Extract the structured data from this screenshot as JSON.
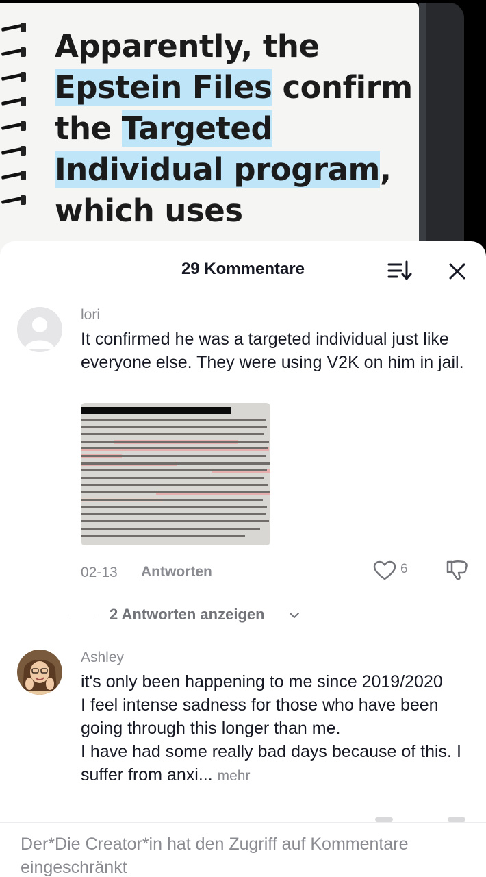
{
  "video": {
    "lines": [
      [
        {
          "text": "Apparently, the",
          "hl": false
        }
      ],
      [
        {
          "text": "Epstein Files",
          "hl": true
        },
        {
          "text": " confirm",
          "hl": false
        }
      ],
      [
        {
          "text": "the ",
          "hl": false
        },
        {
          "text": "Targeted",
          "hl": true
        }
      ],
      [
        {
          "text": "Individual program",
          "hl": true
        },
        {
          "text": ",",
          "hl": false
        }
      ],
      [
        {
          "text": "which uses",
          "hl": false
        }
      ]
    ],
    "highlight_color": "#bfe6f8"
  },
  "sheet": {
    "title": "29 Kommentare",
    "sort_icon": "sort-icon",
    "close_icon": "close-icon"
  },
  "comments": [
    {
      "username": "lori",
      "avatar": "default-avatar-icon",
      "text": "It confirmed he was a targeted individual just like everyone else. They were using V2K on him in jail.",
      "date": "02-13",
      "reply_label": "Antworten",
      "likes": "6",
      "view_replies": "2 Antworten anzeigen"
    },
    {
      "username": "Ashley",
      "avatar": "user-photo-avatar",
      "text_lines": [
        "it's only been happening to me since 2019/2020",
        "I feel intense sadness for those who have been going through this longer than me.",
        "I have had some really bad days because of this. I suffer from anxi..."
      ],
      "more_label": "mehr"
    }
  ],
  "footer": {
    "notice": "Der*Die Creator*in hat den Zugriff auf Kommentare eingeschränkt"
  }
}
